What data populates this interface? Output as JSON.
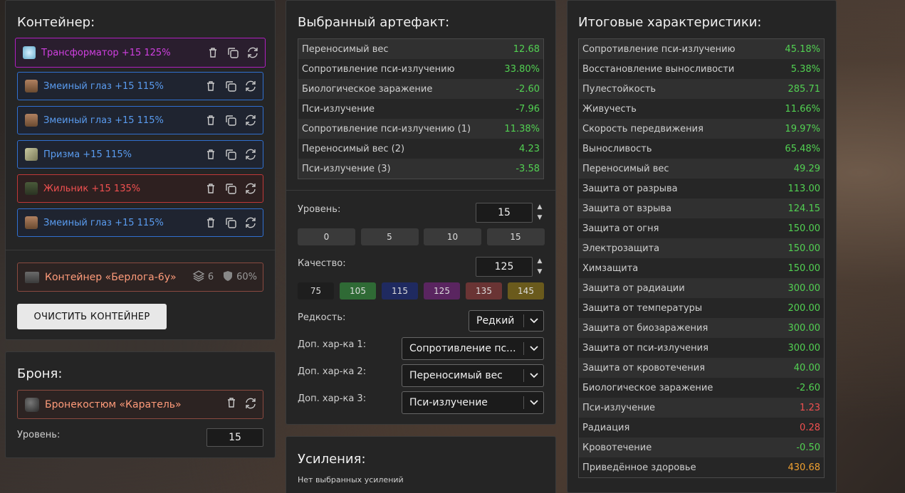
{
  "container": {
    "title": "Контейнер:",
    "slots": [
      {
        "name": "Трансформатор +15 125%",
        "color": "purple",
        "icon": "transformer-icon"
      },
      {
        "name": "Змеиный глаз +15 115%",
        "color": "blue",
        "icon": "snake-eye-icon"
      },
      {
        "name": "Змеиный глаз +15 115%",
        "color": "blue",
        "icon": "snake-eye-icon"
      },
      {
        "name": "Призма +15 115%",
        "color": "blue",
        "icon": "prism-icon"
      },
      {
        "name": "Жильник +15 135%",
        "color": "red",
        "icon": "zhilnik-icon"
      },
      {
        "name": "Змеиный глаз +15 115%",
        "color": "blue",
        "icon": "snake-eye-icon"
      }
    ],
    "box": {
      "name": "Контейнер «Берлога-6у»",
      "slots": "6",
      "protection": "60%"
    },
    "clear_label": "ОЧИСТИТЬ КОНТЕЙНЕР"
  },
  "armor": {
    "title": "Броня:",
    "item": "Бронекостюм «Каратель»",
    "level_label": "Уровень:",
    "level_value": "15"
  },
  "artifact": {
    "title": "Выбранный артефакт:",
    "stats": [
      {
        "label": "Переносимый вес",
        "value": "12.68",
        "tone": "green"
      },
      {
        "label": "Сопротивление пси-излучению",
        "value": "33.80%",
        "tone": "green"
      },
      {
        "label": "Биологическое заражение",
        "value": "-2.60",
        "tone": "green"
      },
      {
        "label": "Пси-излучение",
        "value": "-7.96",
        "tone": "green"
      },
      {
        "label": "Сопротивление пси-излучению (1)",
        "value": "11.38%",
        "tone": "green"
      },
      {
        "label": "Переносимый вес (2)",
        "value": "4.23",
        "tone": "green"
      },
      {
        "label": "Пси-излучение (3)",
        "value": "-3.58",
        "tone": "green"
      }
    ],
    "level_label": "Уровень:",
    "level_value": "15",
    "level_presets": [
      "0",
      "5",
      "10",
      "15"
    ],
    "quality_label": "Качество:",
    "quality_value": "125",
    "quality_presets": [
      {
        "label": "75",
        "color": "#1e1e1e"
      },
      {
        "label": "105",
        "color": "#2f6a35"
      },
      {
        "label": "115",
        "color": "#1f2a60"
      },
      {
        "label": "125",
        "color": "#5a2560"
      },
      {
        "label": "135",
        "color": "#6a3434"
      },
      {
        "label": "145",
        "color": "#6a5a1c"
      }
    ],
    "rarity_label": "Редкость:",
    "rarity_value": "Редкий",
    "extra1_label": "Доп. хар-ка 1:",
    "extra1_value": "Сопротивление пс...",
    "extra2_label": "Доп. хар-ка 2:",
    "extra2_value": "Переносимый вес",
    "extra3_label": "Доп. хар-ка 3:",
    "extra3_value": "Пси-излучение"
  },
  "boosts": {
    "title": "Усиления:",
    "empty": "Нет выбранных усилений"
  },
  "totals": {
    "title": "Итоговые характеристики:",
    "stats": [
      {
        "label": "Сопротивление пси-излучению",
        "value": "45.18%",
        "tone": "green"
      },
      {
        "label": "Восстановление выносливости",
        "value": "5.38%",
        "tone": "green"
      },
      {
        "label": "Пулестойкость",
        "value": "285.71",
        "tone": "green"
      },
      {
        "label": "Живучесть",
        "value": "11.66%",
        "tone": "green"
      },
      {
        "label": "Скорость передвижения",
        "value": "19.97%",
        "tone": "green"
      },
      {
        "label": "Выносливость",
        "value": "65.48%",
        "tone": "green"
      },
      {
        "label": "Переносимый вес",
        "value": "49.29",
        "tone": "green"
      },
      {
        "label": "Защита от разрыва",
        "value": "113.00",
        "tone": "green"
      },
      {
        "label": "Защита от взрыва",
        "value": "124.15",
        "tone": "green"
      },
      {
        "label": "Защита от огня",
        "value": "150.00",
        "tone": "green"
      },
      {
        "label": "Электрозащита",
        "value": "150.00",
        "tone": "green"
      },
      {
        "label": "Химзащита",
        "value": "150.00",
        "tone": "green"
      },
      {
        "label": "Защита от радиации",
        "value": "300.00",
        "tone": "green"
      },
      {
        "label": "Защита от температуры",
        "value": "200.00",
        "tone": "green"
      },
      {
        "label": "Защита от биозаражения",
        "value": "300.00",
        "tone": "green"
      },
      {
        "label": "Защита от пси-излучения",
        "value": "300.00",
        "tone": "green"
      },
      {
        "label": "Защита от кровотечения",
        "value": "40.00",
        "tone": "green"
      },
      {
        "label": "Биологическое заражение",
        "value": "-2.60",
        "tone": "green"
      },
      {
        "label": "Пси-излучение",
        "value": "1.23",
        "tone": "red"
      },
      {
        "label": "Радиация",
        "value": "0.28",
        "tone": "red"
      },
      {
        "label": "Кровотечение",
        "value": "-0.50",
        "tone": "green"
      },
      {
        "label": "Приведённое здоровье",
        "value": "430.68",
        "tone": "orange"
      }
    ]
  }
}
